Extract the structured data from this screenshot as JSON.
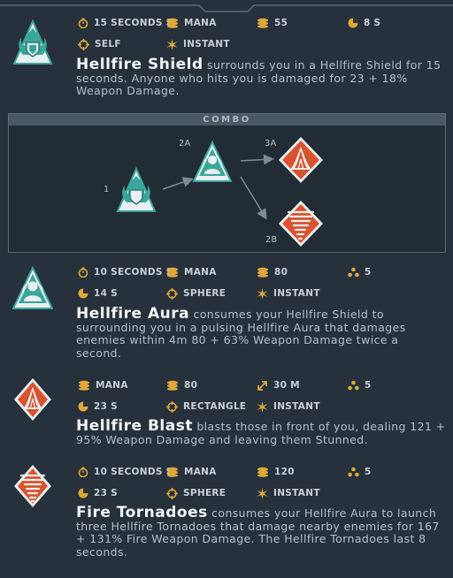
{
  "abilities": [
    {
      "name": "Hellfire Shield",
      "description": " surrounds you in a Hellfire Shield for 15 seconds. Anyone who hits you is damaged for 23 + 18% Weapon Damage.",
      "icon": "hellfire-shield-icon",
      "stats": [
        {
          "icon": "stopwatch-icon",
          "value": "15 SECONDS S"
        },
        {
          "icon": "mana-icon",
          "value": "MANA"
        },
        {
          "icon": "cost-icon",
          "value": "55"
        },
        {
          "icon": "cooldown-icon",
          "value": "8 S"
        },
        {
          "icon": "target-icon",
          "value": "SELF"
        },
        {
          "icon": "instant-icon",
          "value": "INSTANT"
        }
      ]
    },
    {
      "name": "Hellfire Aura",
      "description": " consumes your Hellfire Shield to surrounding you in a pulsing Hellfire Aura that damages enemies within 4m 80 + 63% Weapon Damage twice a second.",
      "icon": "hellfire-aura-icon",
      "stats": [
        {
          "icon": "stopwatch-icon",
          "value": "10 SECONDS S"
        },
        {
          "icon": "mana-icon",
          "value": "MANA"
        },
        {
          "icon": "cost-icon",
          "value": "80"
        },
        {
          "icon": "targets-icon",
          "value": "5"
        },
        {
          "icon": "cooldown-icon",
          "value": "14 S"
        },
        {
          "icon": "target-icon",
          "value": "SPHERE"
        },
        {
          "icon": "instant-icon",
          "value": "INSTANT"
        }
      ]
    },
    {
      "name": "Hellfire Blast",
      "description": " blasts those in front of you, dealing 121 + 95% Weapon Damage and leaving them Stunned.",
      "icon": "hellfire-blast-icon",
      "stats": [
        {
          "icon": "mana-icon",
          "value": "MANA"
        },
        {
          "icon": "cost-icon",
          "value": "80"
        },
        {
          "icon": "range-icon",
          "value": "30 M"
        },
        {
          "icon": "targets-icon",
          "value": "5"
        },
        {
          "icon": "cooldown-icon",
          "value": "23 S"
        },
        {
          "icon": "target-icon",
          "value": "RECTANGLE"
        },
        {
          "icon": "instant-icon",
          "value": "INSTANT"
        }
      ]
    },
    {
      "name": "Fire Tornadoes",
      "description": " consumes your Hellfire Aura to launch three Hellfire Tornadoes that damage nearby enemies for 167 + 131% Fire Weapon Damage. The Hellfire Tornadoes last 8 seconds.",
      "icon": "fire-tornado-icon",
      "stats": [
        {
          "icon": "stopwatch-icon",
          "value": "10 SECONDS S"
        },
        {
          "icon": "mana-icon",
          "value": "MANA"
        },
        {
          "icon": "cost-icon",
          "value": "120"
        },
        {
          "icon": "targets-icon",
          "value": "5"
        },
        {
          "icon": "cooldown-icon",
          "value": "23 S"
        },
        {
          "icon": "target-icon",
          "value": "SPHERE"
        },
        {
          "icon": "instant-icon",
          "value": "INSTANT"
        }
      ]
    }
  ],
  "combo": {
    "title": "COMBO",
    "labels": [
      "1",
      "2A",
      "3A",
      "2B"
    ]
  },
  "colors": {
    "background": "#26313c",
    "teal": "#3aa59b",
    "fire": "#d8532e",
    "gold": "#e0a83a"
  }
}
